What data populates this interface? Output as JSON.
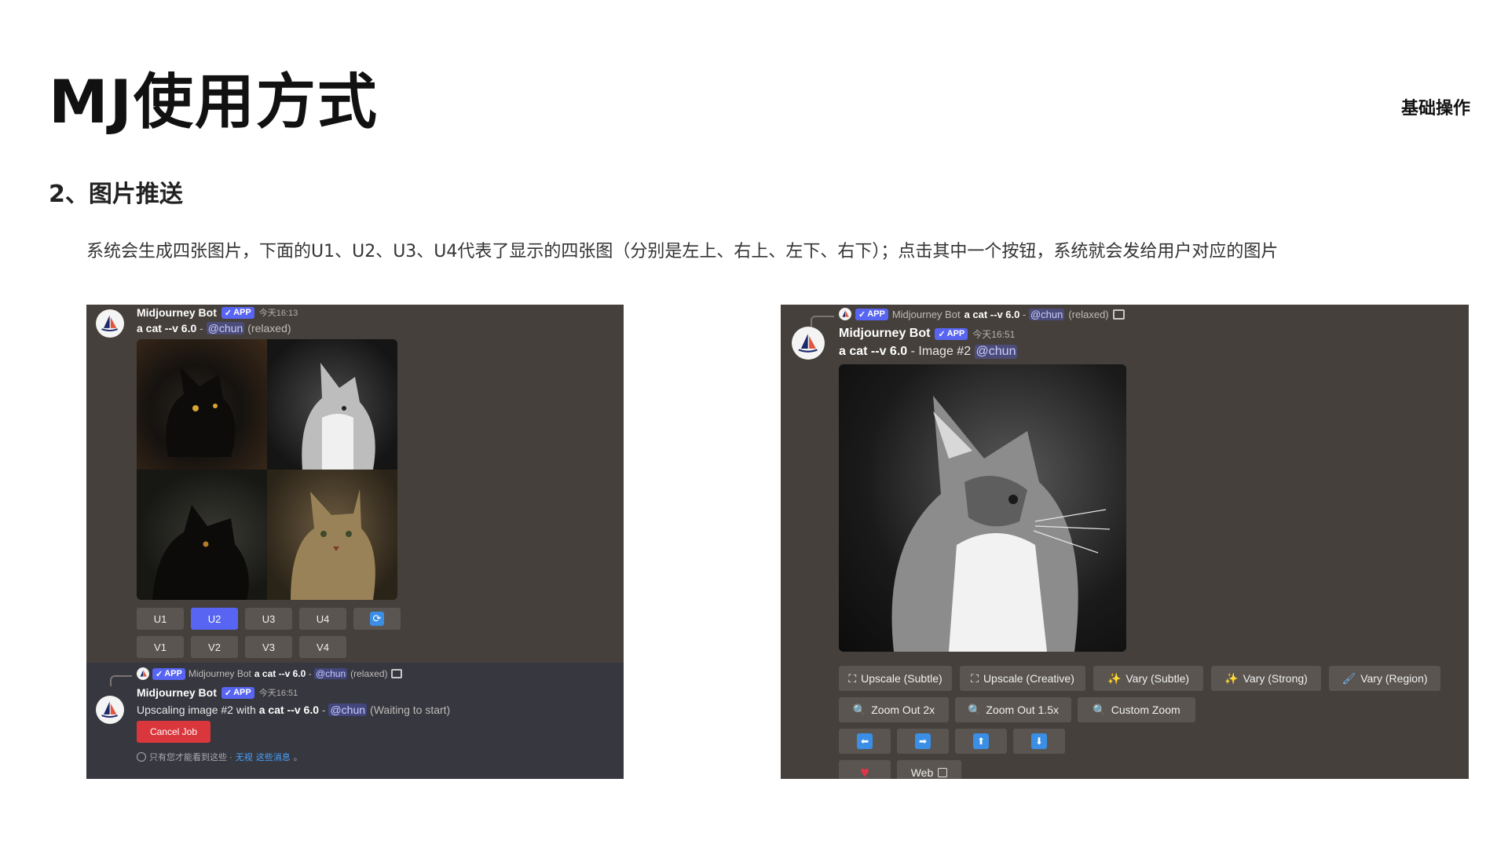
{
  "slide": {
    "title": "MJ使用方式",
    "top_right": "基础操作",
    "section": "2、图片推送",
    "description": "系统会生成四张图片，下面的U1、U2、U3、U4代表了显示的四张图（分别是左上、右上、左下、右下）；点击其中一个按钮，系统就会发给用户对应的图片"
  },
  "left_panel": {
    "msg1": {
      "bot_name": "Midjourney Bot",
      "badge": "APP",
      "time": "今天16:13",
      "prompt": "a cat --v 6.0",
      "sep": " - ",
      "mention": "@chun",
      "mode": "(relaxed)"
    },
    "upscale_buttons": [
      "U1",
      "U2",
      "U3",
      "U4"
    ],
    "variation_buttons": [
      "V1",
      "V2",
      "V3",
      "V4"
    ],
    "active_button": "U2",
    "reroll_icon": "refresh-icon",
    "msg2": {
      "reply_badge": "APP",
      "reply_bot": "Midjourney Bot",
      "reply_prompt": "a cat --v 6.0",
      "reply_sep": " - ",
      "reply_mention": "@chun",
      "reply_mode": "(relaxed)",
      "bot_name": "Midjourney Bot",
      "badge": "APP",
      "time": "今天16:51",
      "status_prefix": "Upscaling image #2 with",
      "status_prompt": "a cat --v 6.0",
      "status_sep": " - ",
      "status_mention": "@chun",
      "status_suffix": "(Waiting to start)",
      "cancel_label": "Cancel Job",
      "ephemeral_text": "只有您才能看到这些 ·",
      "ephemeral_link1": "无视",
      "ephemeral_link2": "这些消息",
      "ephemeral_end": "。"
    }
  },
  "right_panel": {
    "reply": {
      "badge": "APP",
      "bot": "Midjourney Bot",
      "prompt": "a cat --v 6.0",
      "sep": " - ",
      "mention": "@chun",
      "mode": "(relaxed)"
    },
    "msg": {
      "bot_name": "Midjourney Bot",
      "badge": "APP",
      "time": "今天16:51",
      "prompt": "a cat --v 6.0",
      "image_label": " - Image #2 ",
      "mention": "@chun"
    },
    "row1": [
      "Upscale (Subtle)",
      "Upscale (Creative)",
      "Vary (Subtle)",
      "Vary (Strong)",
      "Vary (Region)"
    ],
    "row2": [
      "Zoom Out 2x",
      "Zoom Out 1.5x",
      "Custom Zoom"
    ],
    "pan_buttons": [
      "⬅",
      "➡",
      "⬆",
      "⬇"
    ],
    "web_label": "Web"
  },
  "colors": {
    "panel_bg": "#45403b",
    "blurple": "#5865f2",
    "danger": "#da373c"
  }
}
